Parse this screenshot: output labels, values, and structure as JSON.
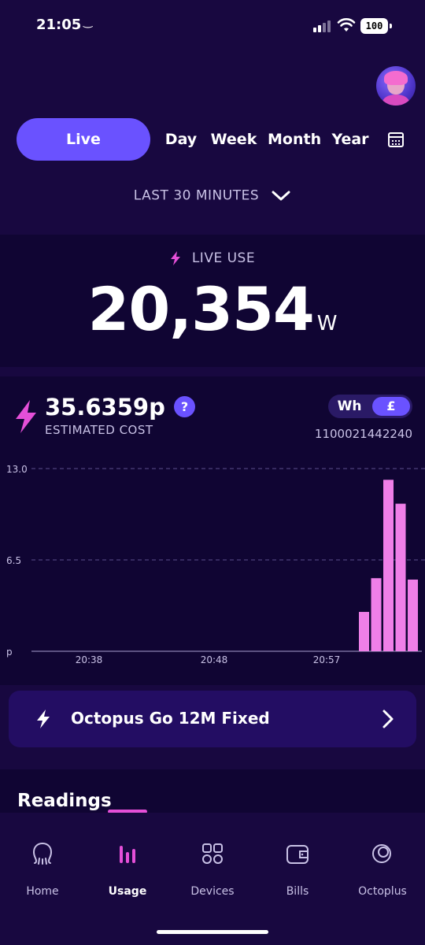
{
  "status_bar": {
    "time": "21:05",
    "battery": "100"
  },
  "tabs": {
    "live": "Live",
    "day": "Day",
    "week": "Week",
    "month": "Month",
    "year": "Year"
  },
  "range": {
    "label": "LAST 30 MINUTES"
  },
  "live_use": {
    "heading": "LIVE USE",
    "value": "20,354",
    "unit": "W"
  },
  "cost": {
    "value": "35.6359p",
    "label": "ESTIMATED COST",
    "help": "?",
    "meter_id": "1100021442240"
  },
  "unit_toggle": {
    "wh": "Wh",
    "gbp": "£",
    "selected": "£"
  },
  "chart_data": {
    "type": "bar",
    "y_ticks": [
      "13.0",
      "6.5",
      "p"
    ],
    "x_ticks": [
      "20:38",
      "20:48",
      "20:57"
    ],
    "ylim": [
      0,
      13
    ],
    "grid": true,
    "bar_color": "#ef7fe8",
    "values": [
      2.8,
      5.2,
      12.2,
      10.5,
      5.1
    ]
  },
  "tariff": {
    "name": "Octopus Go 12M Fixed"
  },
  "readings": {
    "title": "Readings"
  },
  "nav": [
    {
      "label": "Home",
      "icon": "octopus-icon",
      "active": false
    },
    {
      "label": "Usage",
      "icon": "bar-chart-icon",
      "active": true
    },
    {
      "label": "Devices",
      "icon": "grid-icon",
      "active": false
    },
    {
      "label": "Bills",
      "icon": "wallet-icon",
      "active": false
    },
    {
      "label": "Octoplus",
      "icon": "coin-icon",
      "active": false
    }
  ],
  "colors": {
    "background": "#180840",
    "card": "#100533",
    "accent": "#6a52ff",
    "pink": "#e54fd8"
  }
}
